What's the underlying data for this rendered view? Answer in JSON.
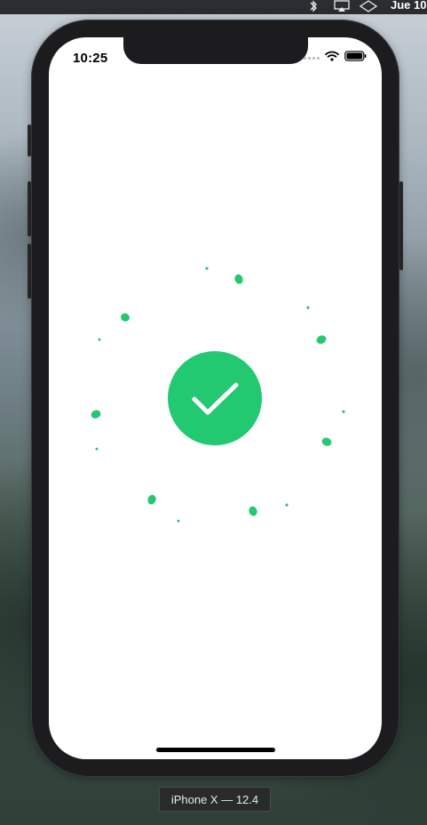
{
  "menubar": {
    "clock": "Jue 10"
  },
  "device": {
    "status_time": "10:25",
    "simulator_label": "iPhone X — 12.4"
  },
  "screen": {
    "state": "success",
    "check_color": "#22c971",
    "confetti_color": "#22c971"
  },
  "icons": {
    "menubar": [
      "bluetooth-icon",
      "airplay-icon",
      "diamond-icon"
    ],
    "status": [
      "cellular-signal-icon",
      "wifi-icon",
      "battery-icon"
    ],
    "main": "checkmark-icon"
  }
}
